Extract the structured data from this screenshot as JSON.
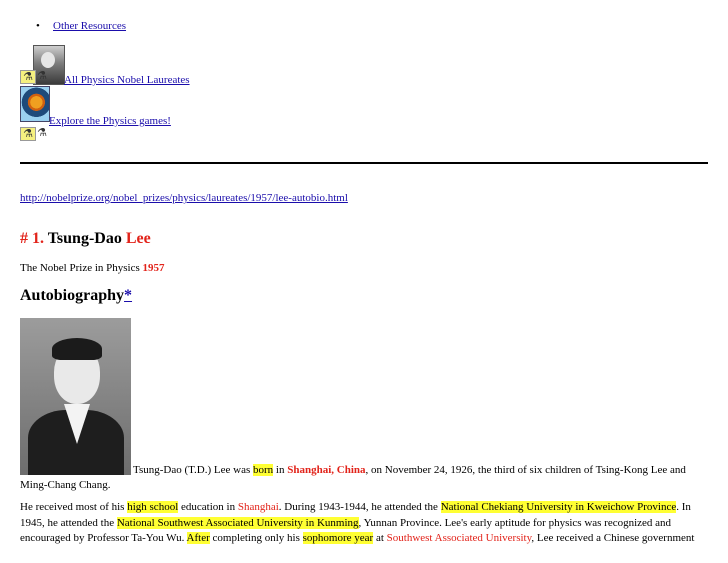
{
  "nav": {
    "bullet": "•",
    "other_resources": "Other Resources",
    "all_laureates": "All Physics Nobel Laureates",
    "games": "Explore the Physics games!"
  },
  "url": "http://nobelprize.org/nobel_prizes/physics/laureates/1957/lee-autobio.html",
  "title": {
    "number": "# 1.",
    "given": "Tsung-Dao",
    "family": "Lee"
  },
  "prize": {
    "text": "The Nobel Prize in Physics",
    "year": "1957"
  },
  "section": {
    "heading": "Autobiography",
    "star": "*"
  },
  "para1": {
    "a": "Tsung-Dao (T.D.) Lee was ",
    "b": "born",
    "c": " in ",
    "d": "Shanghai, China",
    "e": ", on November 24, 1926, the third of six children of Tsing-Kong Lee and",
    "f": "Ming-Chang Chang."
  },
  "para2": {
    "a": "He received most of his ",
    "b": "high school",
    "c": " education in ",
    "d": "Shanghai",
    "e": ". During 1943-1944, he attended the ",
    "f": "National Chekiang University in Kweichow Province",
    "g": ". In 1945, he attended the ",
    "h": "National Southwest Associated University in Kunming",
    "i": ", Yunnan Province. Lee's early aptitude for physics was recognized and encouraged by Professor Ta-You Wu. ",
    "j": "After",
    "k": " completing only his ",
    "l": "sophomore year",
    "m": " at ",
    "n": "Southwest Associated University",
    "o": ", Lee received a Chinese government"
  },
  "icons": {
    "chem": "⚗"
  }
}
